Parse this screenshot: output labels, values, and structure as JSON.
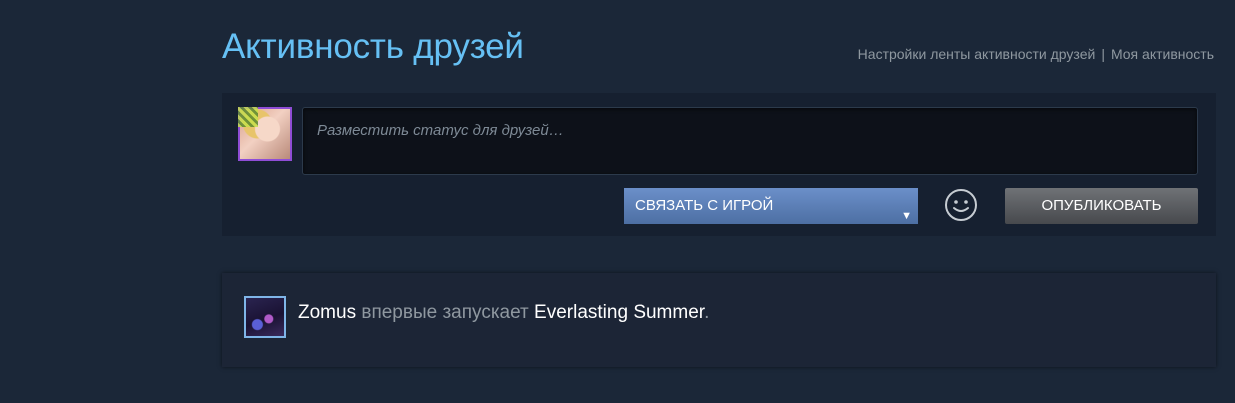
{
  "header": {
    "title": "Активность друзей",
    "links": {
      "feed_settings": "Настройки ленты активности друзей",
      "separator": "|",
      "my_activity": "Моя активность"
    }
  },
  "status": {
    "placeholder": "Разместить статус для друзей…",
    "game_select_label": "СВЯЗАТЬ С ИГРОЙ",
    "game_select_caret": "▼",
    "publish_label": "ОПУБЛИКОВАТЬ",
    "emoticon_icon": "smiley-icon"
  },
  "feed": {
    "items": [
      {
        "user": "Zomus",
        "action": "впервые запускает",
        "game": "Everlasting Summer",
        "punctuation": "."
      }
    ]
  },
  "colors": {
    "background": "#1b2738",
    "title": "#66c0f4",
    "link": "#8f98a0",
    "select_bg": "#5a7fb8",
    "publish_bg": "#5c5f63",
    "avatar_self_border": "#8f4dd6",
    "avatar_friend_border": "#7fb5e8"
  }
}
